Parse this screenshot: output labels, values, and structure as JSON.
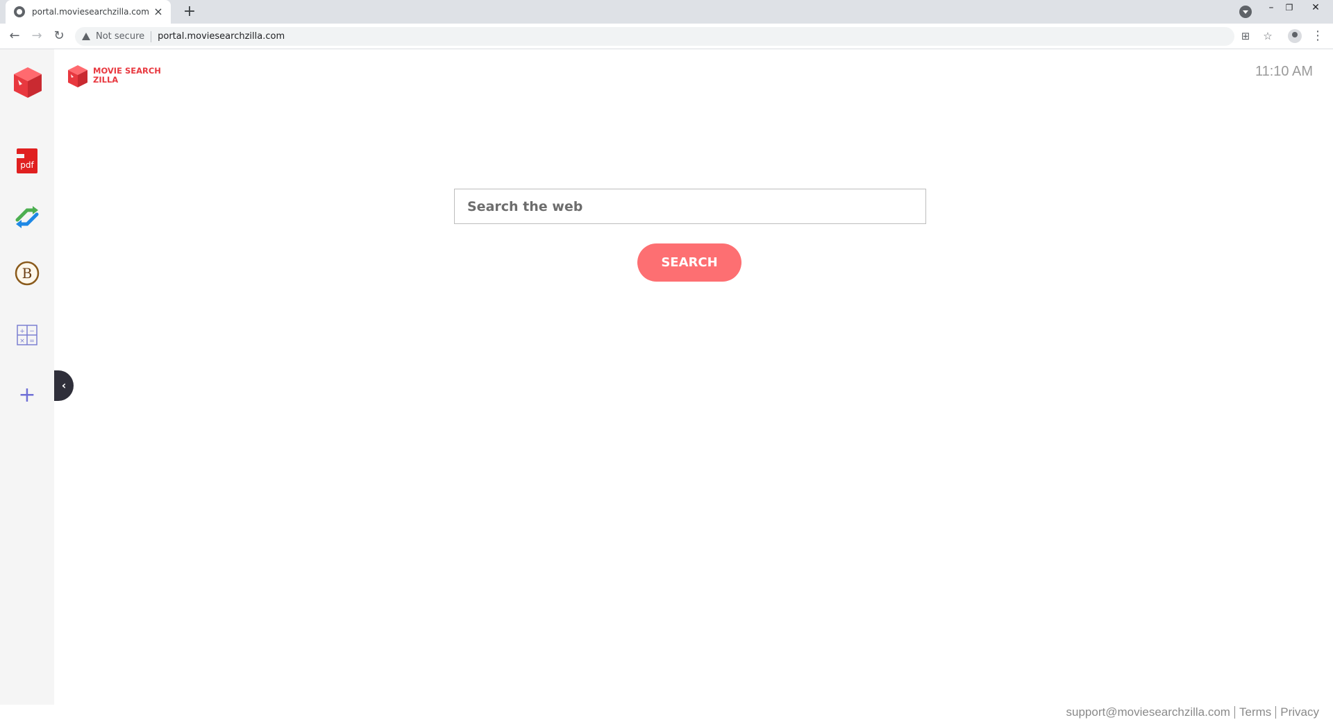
{
  "browser": {
    "tab_title": "portal.moviesearchzilla.com",
    "tab_close": "×",
    "new_tab": "+",
    "security_label": "Not secure",
    "url": "portal.moviesearchzilla.com",
    "window_minimize": "–",
    "window_restore": "❐",
    "window_close": "✕",
    "back": "←",
    "forward": "→",
    "reload": "↻",
    "star": "☆",
    "menu": "⋮",
    "cast": "⊞"
  },
  "brand": {
    "name_line1": "MOVIE SEARCH",
    "name_line2": "ZILLA",
    "accent": "#e8383f"
  },
  "header": {
    "clock": "11:10 AM"
  },
  "sidebar": {
    "items": [
      {
        "name": "pdf-shortcut",
        "icon": "pdf-icon",
        "label": "pdf"
      },
      {
        "name": "converter-shortcut",
        "icon": "swap-arrows-icon"
      },
      {
        "name": "bitcoin-shortcut",
        "icon": "bitcoin-icon",
        "label": "B"
      },
      {
        "name": "calculator-shortcut",
        "icon": "calculator-icon"
      },
      {
        "name": "add-shortcut",
        "icon": "plus-icon",
        "label": "+"
      }
    ],
    "collapse_label": "‹"
  },
  "search": {
    "placeholder": "Search the web",
    "button_label": "SEARCH",
    "button_color": "#fd6f72"
  },
  "footer": {
    "support_email": "support@moviesearchzilla.com",
    "terms": "Terms",
    "privacy": "Privacy"
  }
}
